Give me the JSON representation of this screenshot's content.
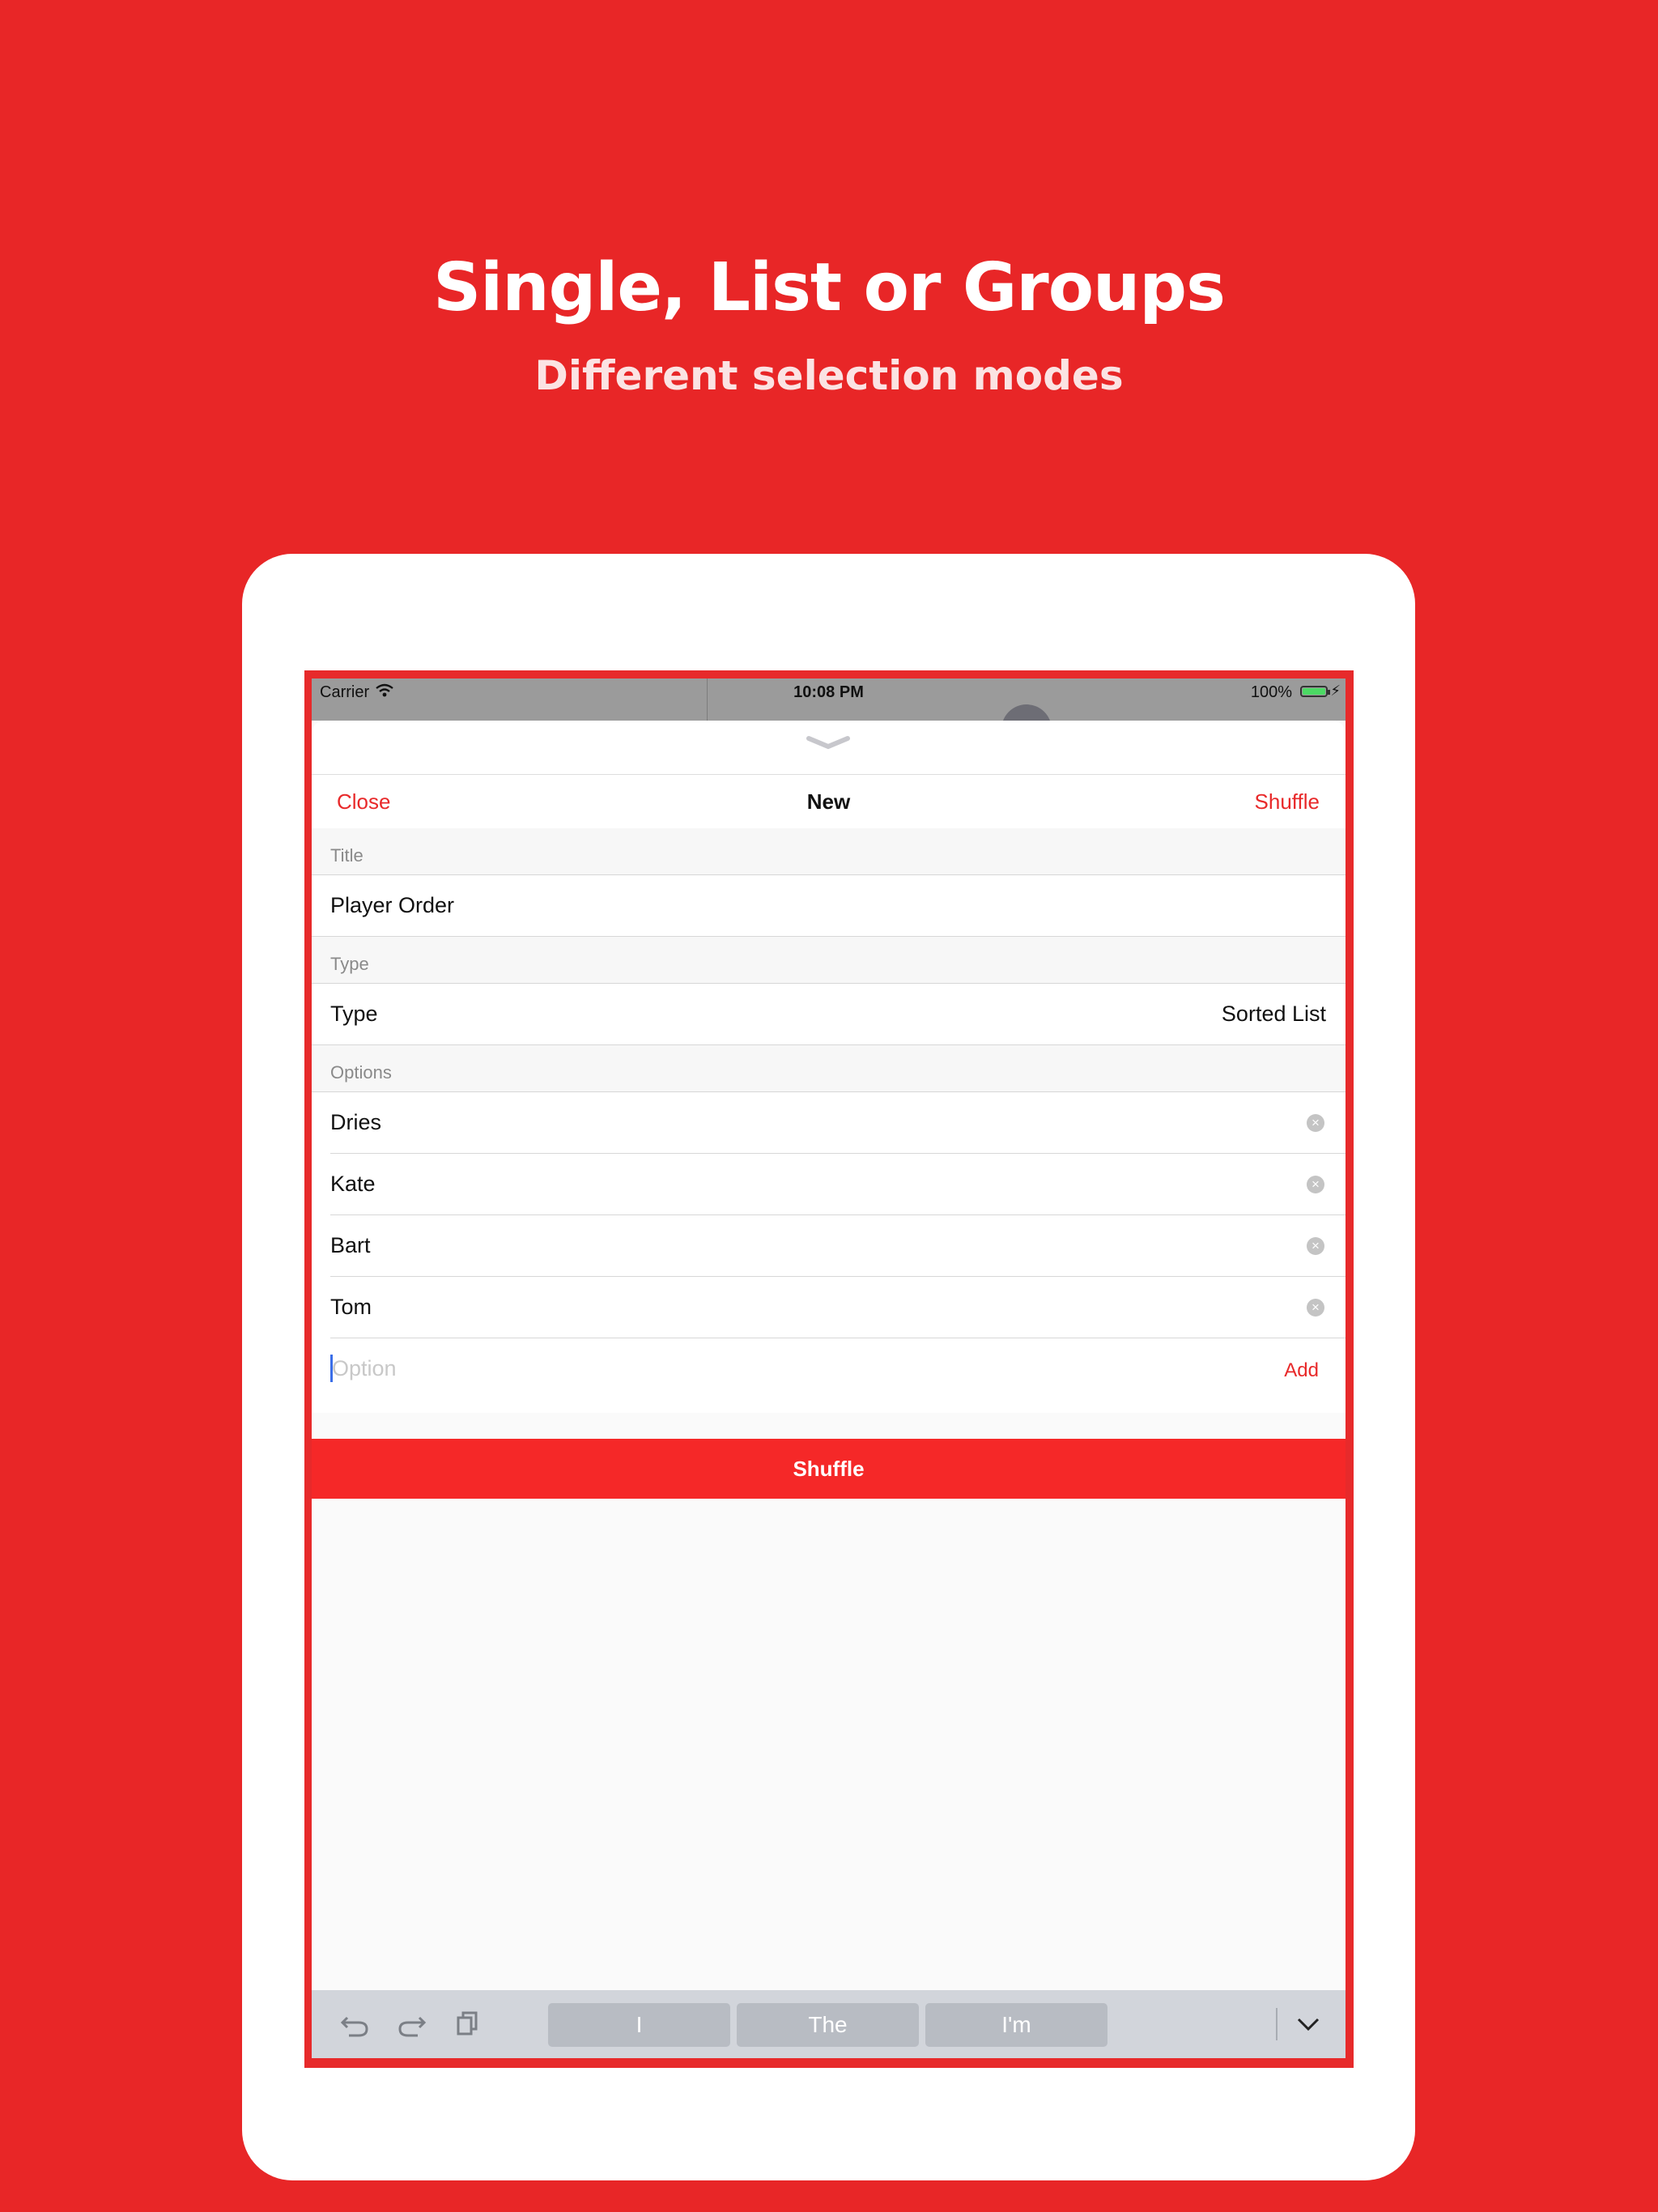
{
  "promo": {
    "headline": "Single, List or Groups",
    "subheadline": "Different selection modes"
  },
  "status_bar": {
    "carrier": "Carrier",
    "time": "10:08 PM",
    "battery": "100%"
  },
  "nav": {
    "close_label": "Close",
    "title": "New",
    "shuffle_label": "Shuffle"
  },
  "form": {
    "title_section": "Title",
    "title_value": "Player Order",
    "type_section": "Type",
    "type_label": "Type",
    "type_value": "Sorted List",
    "options_section": "Options",
    "options": [
      "Dries",
      "Kate",
      "Bart",
      "Tom"
    ],
    "option_placeholder": "Option",
    "add_label": "Add"
  },
  "shuffle_button": "Shuffle",
  "keyboard": {
    "suggestions": [
      "I",
      "The",
      "I'm"
    ]
  },
  "colors": {
    "background": "#e82627",
    "accent": "#e8292a",
    "shuffle_bar": "#f52828"
  }
}
